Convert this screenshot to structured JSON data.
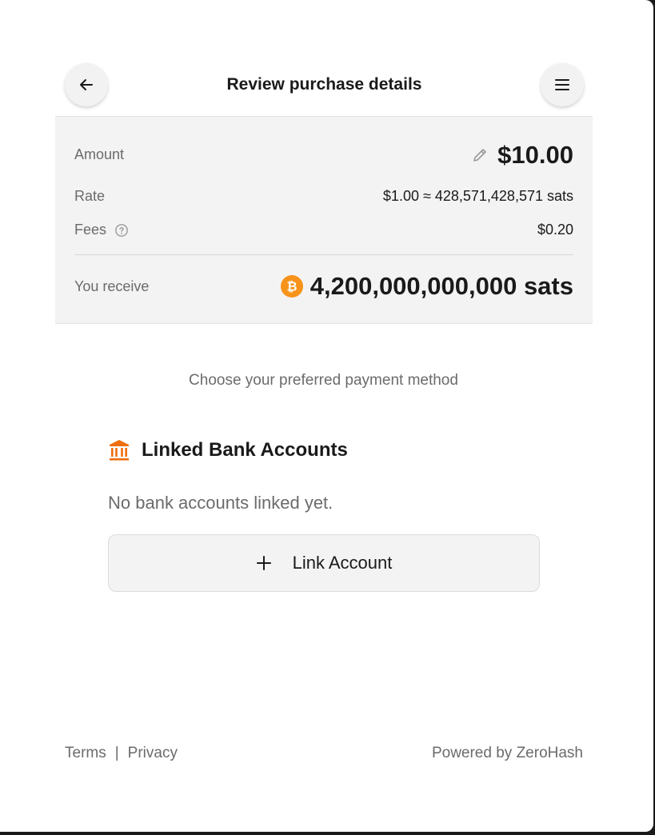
{
  "header": {
    "title": "Review purchase details",
    "back_icon": "arrow-left-icon",
    "menu_icon": "hamburger-menu-icon"
  },
  "summary": {
    "amount_label": "Amount",
    "amount_value": "$10.00",
    "edit_icon": "pencil-icon",
    "rate_label": "Rate",
    "rate_value": "$1.00 ≈ 428,571,428,571 sats",
    "fees_label": "Fees",
    "fees_help_icon": "help-circle-icon",
    "fees_value": "$0.20",
    "receive_label": "You receive",
    "receive_icon": "bitcoin-icon",
    "receive_value": "4,200,000,000,000 sats"
  },
  "payment": {
    "prompt": "Choose your preferred payment method",
    "bank_icon": "bank-icon",
    "bank_heading": "Linked Bank Accounts",
    "empty_text": "No bank accounts linked yet.",
    "link_button_label": "Link Account",
    "link_button_icon": "plus-icon"
  },
  "footer": {
    "terms": "Terms",
    "separator": "|",
    "privacy": "Privacy",
    "powered_by": "Powered by ZeroHash"
  },
  "colors": {
    "accent": "#ee6f0f",
    "bitcoin": "#f7931a",
    "panel_bg": "#f3f3f3",
    "text_primary": "#1a1a1a",
    "text_secondary": "#6b6b6b"
  }
}
